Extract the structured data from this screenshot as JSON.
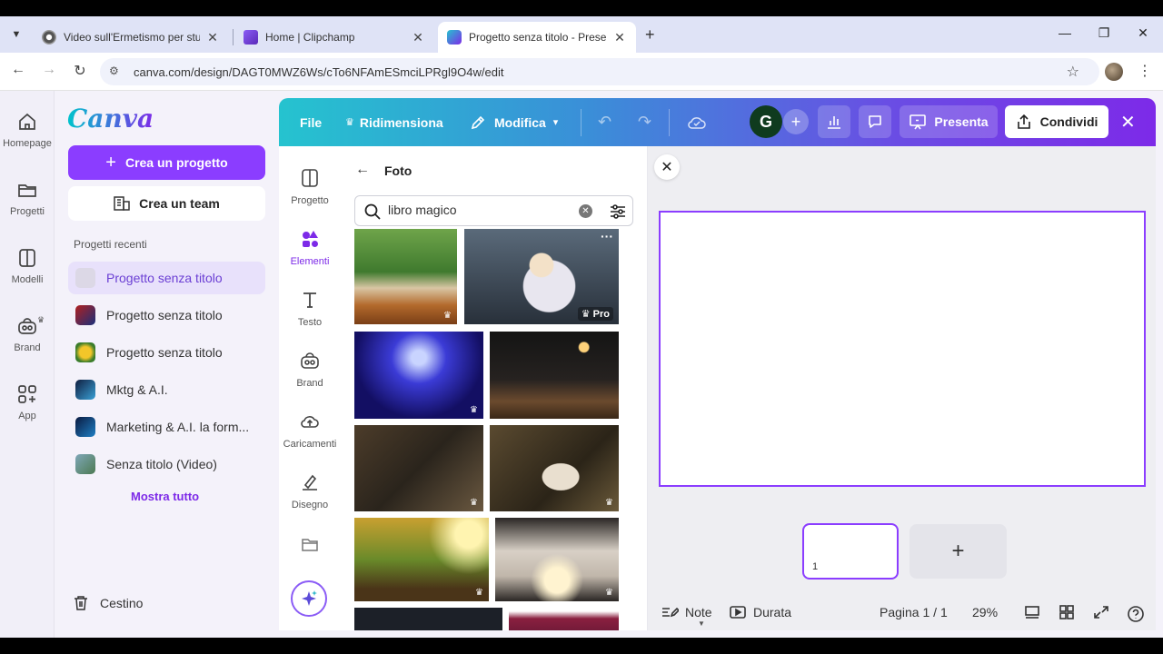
{
  "browser": {
    "tabs": [
      {
        "title": "Video sull'Ermetismo per stude",
        "active": false
      },
      {
        "title": "Home | Clipchamp",
        "active": false
      },
      {
        "title": "Progetto senza titolo - Presenta",
        "active": true
      }
    ],
    "url": "canva.com/design/DAGT0MWZ6Ws/cTo6NFAmESmciLPRgl9O4w/edit"
  },
  "rail": {
    "items": [
      "Homepage",
      "Progetti",
      "Modelli",
      "Brand",
      "App"
    ]
  },
  "sidebar": {
    "logo": "Canva",
    "create_label": "Crea un progetto",
    "team_label": "Crea un team",
    "recent_heading": "Progetti recenti",
    "recent": [
      "Progetto senza titolo",
      "Progetto senza titolo",
      "Progetto senza titolo",
      "Mktg & A.I.",
      "Marketing & A.I. la form...",
      "Senza titolo (Video)"
    ],
    "show_all": "Mostra tutto",
    "trash": "Cestino"
  },
  "toolbar": {
    "file": "File",
    "resize": "Ridimensiona",
    "edit": "Modifica",
    "avatar_initial": "G",
    "present": "Presenta",
    "share": "Condividi"
  },
  "objects": {
    "items": [
      "Progetto",
      "Elementi",
      "Testo",
      "Brand",
      "Caricamenti",
      "Disegno"
    ]
  },
  "photos": {
    "title": "Foto",
    "search_value": "libro magico",
    "pro_badge": "Pro"
  },
  "pages": {
    "current_page_number": "1"
  },
  "footer": {
    "notes": "Note",
    "duration": "Durata",
    "page_info": "Pagina 1 / 1",
    "zoom": "29%"
  },
  "colors": {
    "accent": "#8b3dff",
    "brand_gradient_start": "#25c3cf",
    "brand_gradient_end": "#7d2ae8"
  }
}
